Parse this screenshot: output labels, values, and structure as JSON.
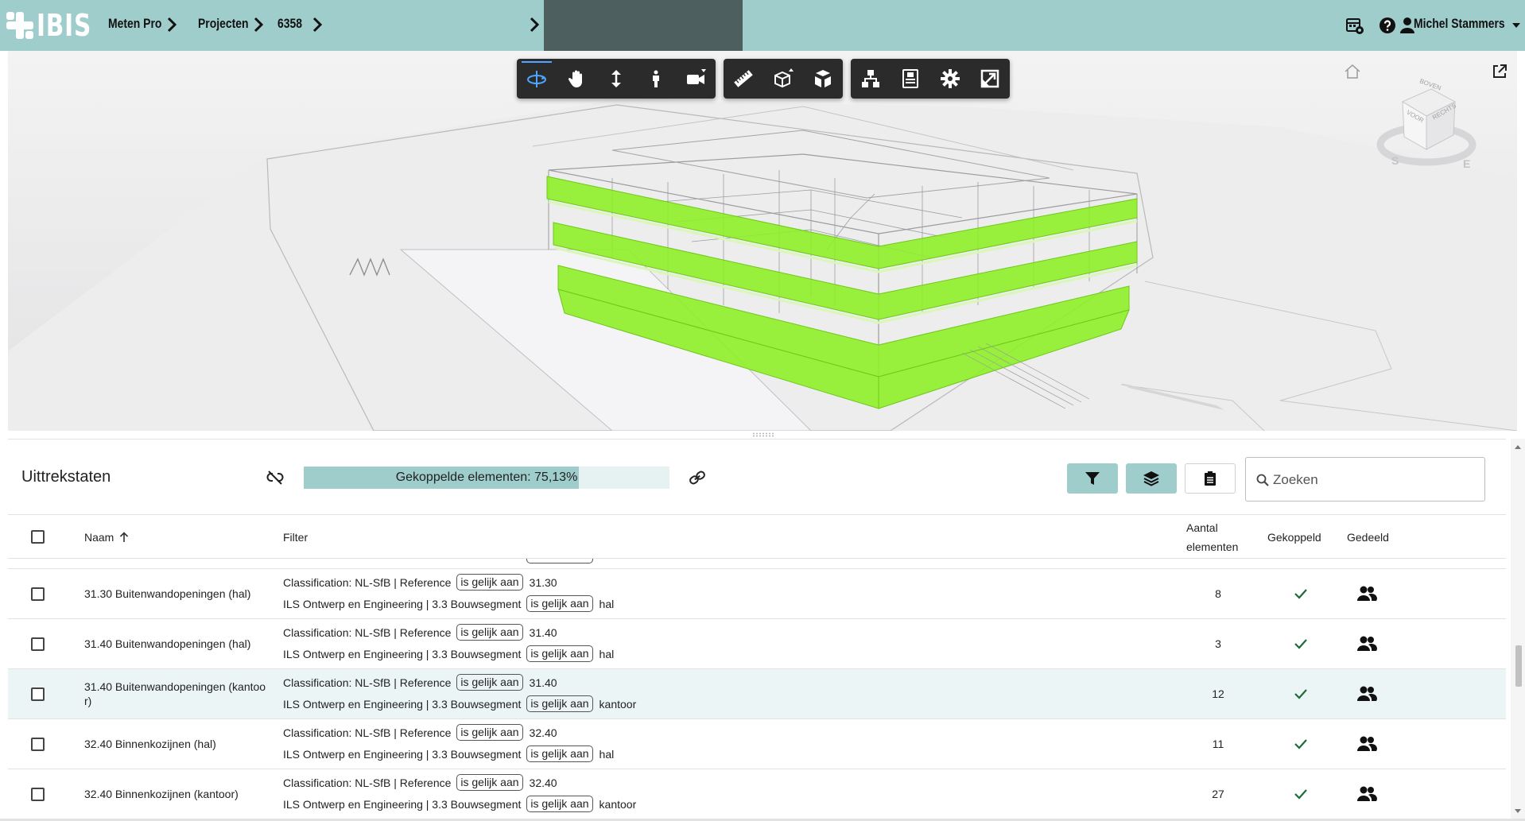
{
  "topbar": {
    "logo_text": "IBIS",
    "breadcrumb": [
      "Meten Pro",
      "Projecten",
      "6358"
    ],
    "user_name": "Michel Stammers",
    "accent_color": "#9fcdcc"
  },
  "viewer": {
    "toolbar_groups": [
      [
        "orbit-icon",
        "pan-icon",
        "zoom-icon",
        "first-person-icon",
        "camera-icon"
      ],
      [
        "measure-icon",
        "section-icon",
        "explode-icon"
      ],
      [
        "model-browser-icon",
        "properties-icon",
        "settings-icon",
        "fullscreen-icon"
      ]
    ],
    "viewcube_labels": [
      "BOVEN",
      "VOOR",
      "RECHTS",
      "S",
      "E"
    ],
    "highlight_color": "#8ef028"
  },
  "panel": {
    "title": "Uittrekstaten",
    "progress_label": "Gekoppelde elementen: 75,13%",
    "progress_value": 0.7513,
    "search_placeholder": "Zoeken",
    "columns": {
      "name": "Naam",
      "filter": "Filter",
      "count_line1": "Aantal",
      "count_line2": "elementen",
      "linked": "Gekoppeld",
      "shared": "Gedeeld"
    },
    "rows": [
      {
        "name": "31.30 Buitenwandopeningen (hal)",
        "filter1_prefix": "Classification: NL-SfB | Reference",
        "filter1_op": "is gelijk aan",
        "filter1_value": "31.30",
        "filter2_prefix": "ILS Ontwerp en Engineering | 3.3 Bouwsegment",
        "filter2_op": "is gelijk aan",
        "filter2_value": "hal",
        "count": "8"
      },
      {
        "name": "31.40 Buitenwandopeningen (hal)",
        "filter1_prefix": "Classification: NL-SfB | Reference",
        "filter1_op": "is gelijk aan",
        "filter1_value": "31.40",
        "filter2_prefix": "ILS Ontwerp en Engineering | 3.3 Bouwsegment",
        "filter2_op": "is gelijk aan",
        "filter2_value": "hal",
        "count": "3"
      },
      {
        "name": "31.40 Buitenwandopeningen (kantoor)",
        "filter1_prefix": "Classification: NL-SfB | Reference",
        "filter1_op": "is gelijk aan",
        "filter1_value": "31.40",
        "filter2_prefix": "ILS Ontwerp en Engineering | 3.3 Bouwsegment",
        "filter2_op": "is gelijk aan",
        "filter2_value": "kantoor",
        "count": "12"
      },
      {
        "name": "32.40 Binnenkozijnen (hal)",
        "filter1_prefix": "Classification: NL-SfB | Reference",
        "filter1_op": "is gelijk aan",
        "filter1_value": "32.40",
        "filter2_prefix": "ILS Ontwerp en Engineering | 3.3 Bouwsegment",
        "filter2_op": "is gelijk aan",
        "filter2_value": "hal",
        "count": "11"
      },
      {
        "name": "32.40 Binnenkozijnen (kantoor)",
        "filter1_prefix": "Classification: NL-SfB | Reference",
        "filter1_op": "is gelijk aan",
        "filter1_value": "32.40",
        "filter2_prefix": "ILS Ontwerp en Engineering | 3.3 Bouwsegment",
        "filter2_op": "is gelijk aan",
        "filter2_value": "kantoor",
        "count": "27"
      }
    ]
  }
}
